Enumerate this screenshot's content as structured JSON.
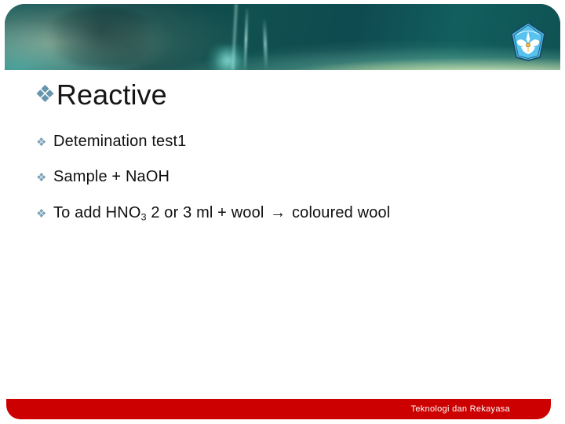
{
  "slide": {
    "background_color": "#ffffff",
    "header": {
      "banner_name": "teal-glass-abstract-banner",
      "banner_colors": [
        "#0c4143",
        "#12585a",
        "#d6ebb4",
        "#3ccdcd"
      ],
      "logo": {
        "icon_name": "tut-wuri-handayani-logo",
        "description": "ministry of education emblem",
        "colors": [
          "#4db8e8",
          "#ffffff",
          "#1a4d6b"
        ]
      }
    },
    "title": {
      "bullet": "❖",
      "text": "Reactive",
      "bullet_color": "#6795ad",
      "text_color": "#161616"
    },
    "bullets": [
      {
        "marker": "❖",
        "parts": [
          {
            "text": "Detemination test1",
            "sub": false
          }
        ]
      },
      {
        "marker": "❖",
        "parts": [
          {
            "text": "Sample + NaOH",
            "sub": false
          }
        ]
      },
      {
        "marker": "❖",
        "parts": [
          {
            "text": "To add HNO",
            "sub": false
          },
          {
            "text": "3",
            "sub": true
          },
          {
            "text": " 2 or 3 ml + wool ",
            "sub": false
          },
          {
            "text": "→",
            "sub": false,
            "arrow": true
          },
          {
            "text": " coloured wool",
            "sub": false
          }
        ]
      }
    ],
    "footer": {
      "text": "Teknologi dan Rekayasa",
      "bar_color": "#cc0000",
      "text_color": "#ffffff"
    }
  }
}
